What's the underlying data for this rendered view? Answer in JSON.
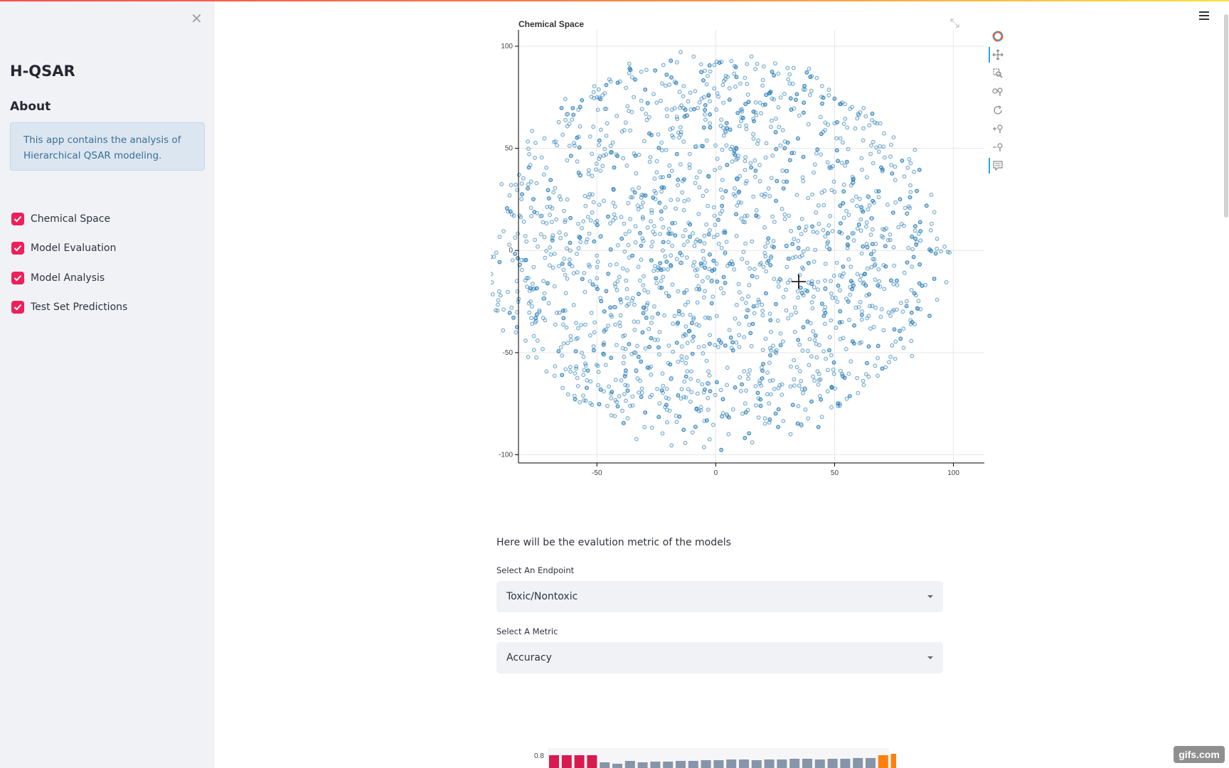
{
  "sidebar": {
    "close_icon": "close-icon",
    "app_title": "H-QSAR",
    "about_heading": "About",
    "about_text": "This app contains the analysis of Hierarchical QSAR modeling.",
    "items": [
      {
        "label": "Chemical Space",
        "checked": true
      },
      {
        "label": "Model Evaluation",
        "checked": true
      },
      {
        "label": "Model Analysis",
        "checked": true
      },
      {
        "label": "Test Set Predictions",
        "checked": true
      }
    ],
    "checkbox_color": "#ef1f5a"
  },
  "main": {
    "evaluation_text": "Here will be the evalution metric of the models",
    "endpoint_select": {
      "label": "Select An Endpoint",
      "value": "Toxic/Nontoxic"
    },
    "metric_select": {
      "label": "Select A Metric",
      "value": "Accuracy"
    },
    "bar_preview_label": "0.8"
  },
  "toolbar_icons": [
    "bokeh-logo-icon",
    "pan-icon",
    "box-zoom-icon",
    "wheel-zoom-icon",
    "reset-icon",
    "zoom-in-icon",
    "zoom-out-icon",
    "hover-icon"
  ],
  "watermark": "gifs.com",
  "chart_data": {
    "type": "scatter",
    "title": "Chemical Space",
    "xlabel": "",
    "ylabel": "",
    "xlim": [
      -83,
      113
    ],
    "ylim": [
      -104,
      108
    ],
    "x_ticks": [
      -50,
      0,
      50,
      100
    ],
    "y_ticks": [
      -100,
      -50,
      0,
      50,
      100
    ],
    "grid": true,
    "marker_color": "#1f77b4",
    "marker_style": "open-circle",
    "approx_point_count": 1800,
    "description_note": "Roughly circular cloud of points centered near (0, 0) with radius about 95 in both axes",
    "center": [
      0,
      0
    ],
    "radius": 95
  }
}
